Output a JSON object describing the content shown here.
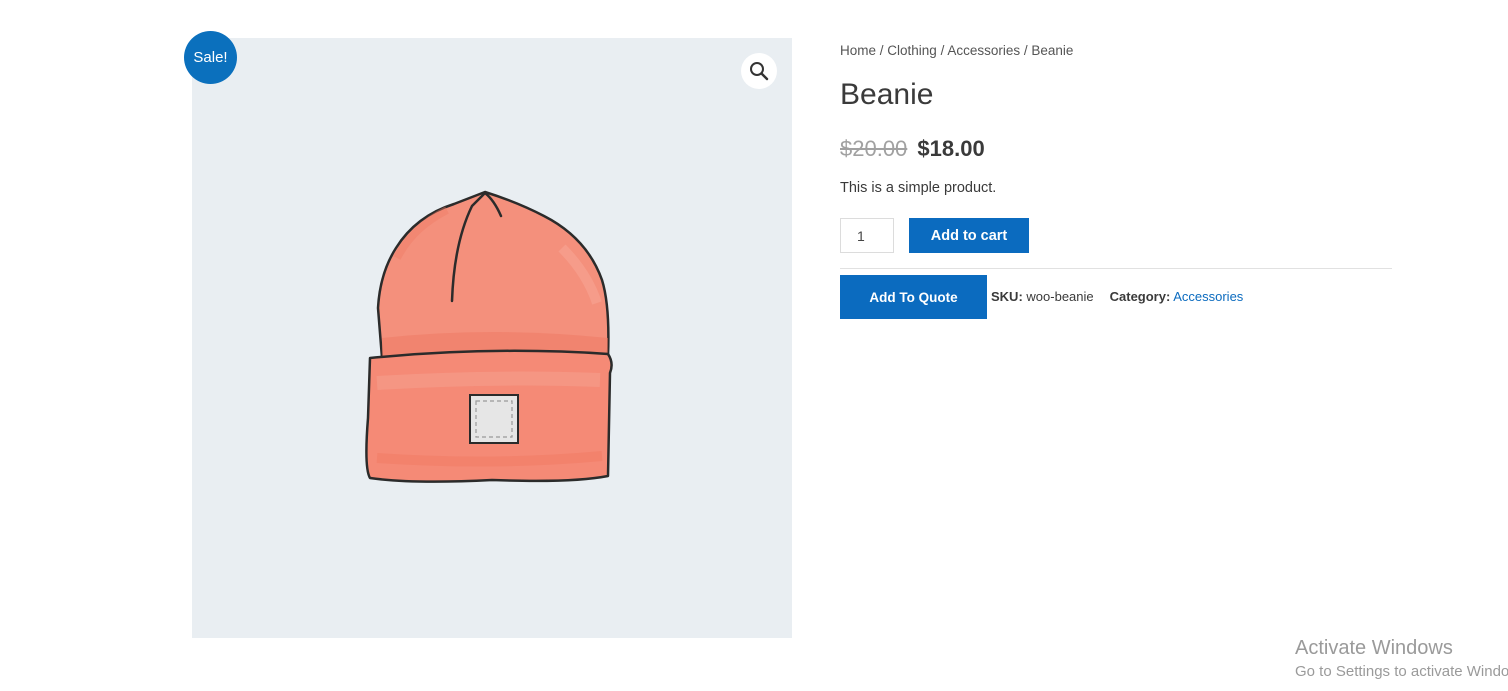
{
  "badge": {
    "sale": "Sale!"
  },
  "icons": {
    "zoom": "magnifier-icon",
    "product": "beanie-illustration"
  },
  "breadcrumb": {
    "items": [
      "Home",
      "Clothing",
      "Accessories",
      "Beanie"
    ],
    "separator": " / "
  },
  "product": {
    "title": "Beanie",
    "regular_price": "$20.00",
    "sale_price": "$18.00",
    "short_description": "This is a simple product.",
    "quantity": "1",
    "add_to_cart_label": "Add to cart",
    "add_to_quote_label": "Add To Quote",
    "sku_label": "SKU:",
    "sku": "woo-beanie",
    "category_label": "Category:",
    "category": "Accessories"
  },
  "watermark": {
    "line1": "Activate Windows",
    "line2": "Go to Settings to activate Windows."
  },
  "colors": {
    "accent": "#0b6bbf",
    "gallery_bg": "#e9eef2",
    "beanie": "#f4907c",
    "text": "#3a3a3a"
  }
}
